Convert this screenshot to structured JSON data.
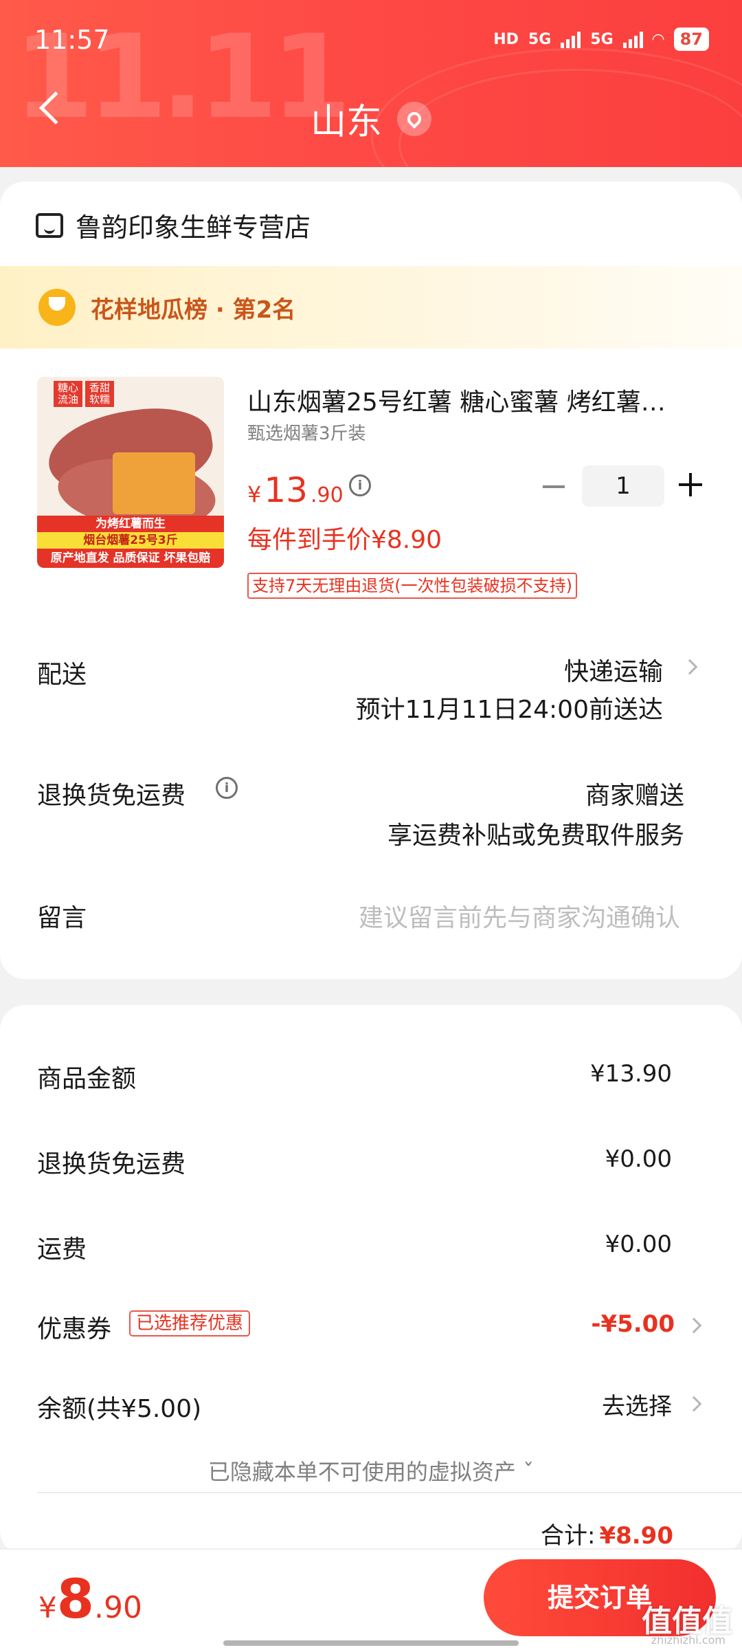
{
  "status_bar": {
    "time": "11:57",
    "network": "5G",
    "network2": "5G",
    "hd": "HD",
    "battery": "87"
  },
  "header": {
    "watermark": "11.11",
    "title": "山东"
  },
  "store": {
    "name": "鲁韵印象生鲜专营店"
  },
  "rank": {
    "text": "花样地瓜榜 · 第2名"
  },
  "product": {
    "image_tags": [
      "糖心流油",
      "香甜软糯"
    ],
    "image_banners": [
      "为烤红薯而生",
      "烟台烟薯25号3斤",
      "原产地直发 品质保证 坏果包赔"
    ],
    "name": "山东烟薯25号红薯 糖心蜜薯 烤红薯…",
    "spec": "甄选烟薯3斤装",
    "price_currency": "¥",
    "price_int": "13",
    "price_dec": ".90",
    "quantity": "1",
    "net_price": "每件到手价¥8.90",
    "policy": "支持7天无理由退货(一次性包装破损不支持)"
  },
  "delivery": {
    "label": "配送",
    "method": "快递运输",
    "eta": "预计11月11日24:00前送达"
  },
  "return_shipping": {
    "label": "退换货免运费",
    "value": "商家赠送",
    "desc": "享运费补贴或免费取件服务"
  },
  "message": {
    "label": "留言",
    "placeholder": "建议留言前先与商家沟通确认"
  },
  "summary": {
    "goods_label": "商品金额",
    "goods_value": "¥13.90",
    "return_label": "退换货免运费",
    "return_value": "¥0.00",
    "shipping_label": "运费",
    "shipping_value": "¥0.00",
    "coupon_label": "优惠券",
    "coupon_tag": "已选推荐优惠",
    "coupon_value": "-¥5.00",
    "balance_label": "余额(共¥5.00)",
    "balance_value": "去选择",
    "hidden_note": "已隐藏本单不可使用的虚拟资产 ˇ",
    "total_label": "合计:",
    "total_value": "¥8.90"
  },
  "bottom": {
    "currency": "¥",
    "int": "8",
    "dec": ".90",
    "submit": "提交订单"
  },
  "watermark_site": {
    "logo": "值值值",
    "url": "zhizhizhi.com"
  },
  "colors": {
    "brand_red": "#e8321f",
    "header_red": "#fe4a45",
    "rank_text": "#c9561a"
  }
}
